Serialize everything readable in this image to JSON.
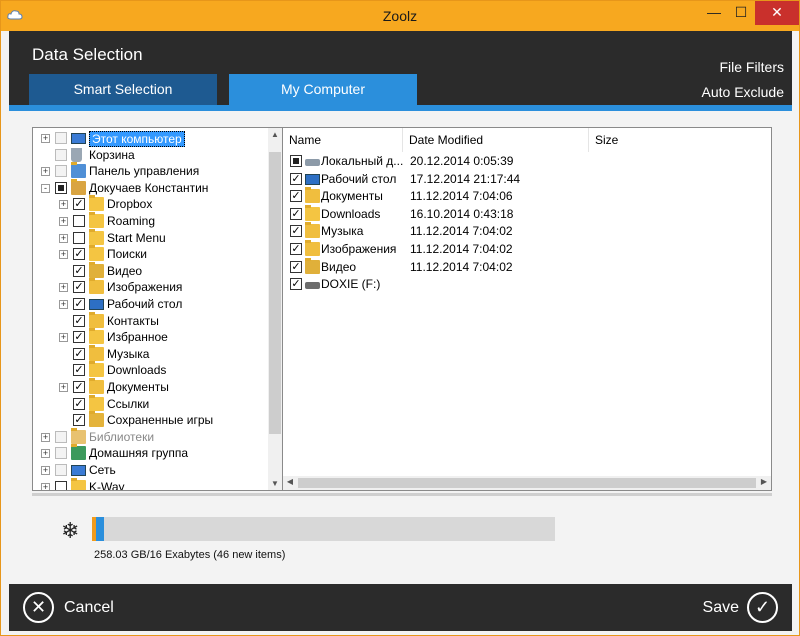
{
  "window": {
    "title": "Zoolz",
    "min_glyph": "—",
    "max_glyph": "☐",
    "close_glyph": "✕"
  },
  "header": {
    "heading": "Data Selection",
    "links": [
      "File Filters",
      "Auto Exclude"
    ],
    "tabs": [
      {
        "label": "Smart Selection",
        "active": false
      },
      {
        "label": "My Computer",
        "active": true
      }
    ]
  },
  "tree": {
    "items": [
      {
        "label": "Этот компьютер",
        "icon": "computer-icon",
        "check": "disabled",
        "expander": "+",
        "selected": true
      },
      {
        "label": "Корзина",
        "icon": "recycle-bin-icon",
        "check": "disabled",
        "expander": ""
      },
      {
        "label": "Панель управления",
        "icon": "control-panel-icon",
        "check": "disabled",
        "expander": "+"
      },
      {
        "label": "Докучаев Константин",
        "icon": "user-folder-icon",
        "check": "partial",
        "expander": "-"
      },
      {
        "label": "Dropbox",
        "icon": "folder-icon",
        "check": "checked",
        "expander": "+"
      },
      {
        "label": "Roaming",
        "icon": "folder-icon",
        "check": "unchecked",
        "expander": "+"
      },
      {
        "label": "Start Menu",
        "icon": "folder-icon",
        "check": "unchecked",
        "expander": "+"
      },
      {
        "label": "Поиски",
        "icon": "search-folder-icon",
        "check": "checked",
        "expander": "+"
      },
      {
        "label": "Видео",
        "icon": "video-folder-icon",
        "check": "checked",
        "expander": ""
      },
      {
        "label": "Изображения",
        "icon": "pictures-folder-icon",
        "check": "checked",
        "expander": "+"
      },
      {
        "label": "Рабочий стол",
        "icon": "desktop-icon",
        "check": "checked",
        "expander": "+"
      },
      {
        "label": "Контакты",
        "icon": "contacts-folder-icon",
        "check": "checked",
        "expander": ""
      },
      {
        "label": "Избранное",
        "icon": "favorites-folder-icon",
        "check": "checked",
        "expander": "+"
      },
      {
        "label": "Музыка",
        "icon": "music-folder-icon",
        "check": "checked",
        "expander": ""
      },
      {
        "label": "Downloads",
        "icon": "downloads-folder-icon",
        "check": "checked",
        "expander": ""
      },
      {
        "label": "Документы",
        "icon": "documents-folder-icon",
        "check": "checked",
        "expander": "+"
      },
      {
        "label": "Ссылки",
        "icon": "links-folder-icon",
        "check": "checked",
        "expander": ""
      },
      {
        "label": "Сохраненные игры",
        "icon": "saved-games-folder-icon",
        "check": "checked",
        "expander": ""
      },
      {
        "label": "Библиотеки",
        "icon": "libraries-icon",
        "check": "disabled",
        "expander": "+",
        "grey": true
      },
      {
        "label": "Домашняя группа",
        "icon": "homegroup-icon",
        "check": "disabled",
        "expander": "+"
      },
      {
        "label": "Сеть",
        "icon": "network-icon",
        "check": "disabled",
        "expander": "+"
      },
      {
        "label": "K-Way",
        "icon": "folder-icon",
        "check": "unchecked",
        "expander": "+"
      }
    ]
  },
  "files": {
    "columns": [
      "Name",
      "Date Modified",
      "Size"
    ],
    "rows": [
      {
        "name": "Локальный д...",
        "date": "20.12.2014 0:05:39",
        "icon": "local-disk-icon",
        "check": "partial"
      },
      {
        "name": "Рабочий стол",
        "date": "17.12.2014 21:17:44",
        "icon": "desktop-icon",
        "check": "checked"
      },
      {
        "name": "Документы",
        "date": "11.12.2014 7:04:06",
        "icon": "documents-folder-icon",
        "check": "checked"
      },
      {
        "name": "Downloads",
        "date": "16.10.2014 0:43:18",
        "icon": "downloads-folder-icon",
        "check": "checked"
      },
      {
        "name": "Музыка",
        "date": "11.12.2014 7:04:02",
        "icon": "music-folder-icon",
        "check": "checked"
      },
      {
        "name": "Изображения",
        "date": "11.12.2014 7:04:02",
        "icon": "pictures-folder-icon",
        "check": "checked"
      },
      {
        "name": "Видео",
        "date": "11.12.2014 7:04:02",
        "icon": "video-folder-icon",
        "check": "checked"
      },
      {
        "name": "DOXIE (F:)",
        "date": "",
        "icon": "removable-drive-icon",
        "check": "checked"
      }
    ]
  },
  "storage": {
    "text": "258.03 GB/16 Exabytes (46 new items)",
    "icon": "snowflake-icon",
    "used_fraction": 0.025
  },
  "footer": {
    "cancel_label": "Cancel",
    "save_label": "Save"
  },
  "colors": {
    "accent_orange": "#f7a81f",
    "accent_blue": "#2b8fdc",
    "dark": "#2b2b2b"
  }
}
